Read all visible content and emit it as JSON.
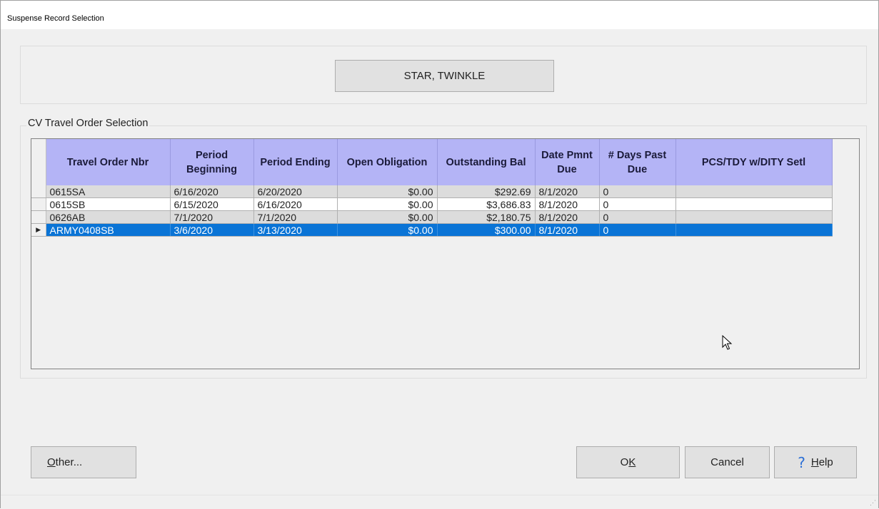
{
  "window": {
    "title": "Suspense Record Selection"
  },
  "member": {
    "name": "STAR, TWINKLE"
  },
  "group": {
    "label": "CV Travel Order Selection"
  },
  "grid": {
    "columns": [
      "Travel Order Nbr",
      "Period Beginning",
      "Period Ending",
      "Open Obligation",
      "Outstanding Bal",
      "Date Pmnt Due",
      "# Days Past Due",
      "PCS/TDY w/DITY Setl"
    ],
    "rows": [
      {
        "order": "0615SA",
        "begin": "6/16/2020",
        "end": "6/20/2020",
        "open": "$0.00",
        "bal": "$292.69",
        "due": "8/1/2020",
        "days": "0",
        "pcs": ""
      },
      {
        "order": "0615SB",
        "begin": "6/15/2020",
        "end": "6/16/2020",
        "open": "$0.00",
        "bal": "$3,686.83",
        "due": "8/1/2020",
        "days": "0",
        "pcs": ""
      },
      {
        "order": "0626AB",
        "begin": "7/1/2020",
        "end": "7/1/2020",
        "open": "$0.00",
        "bal": "$2,180.75",
        "due": "8/1/2020",
        "days": "0",
        "pcs": ""
      },
      {
        "order": "ARMY0408SB",
        "begin": "3/6/2020",
        "end": "3/13/2020",
        "open": "$0.00",
        "bal": "$300.00",
        "due": "8/1/2020",
        "days": "0",
        "pcs": ""
      }
    ],
    "selected_row_index": 3,
    "current_row_marker": "▶"
  },
  "buttons": {
    "other_prefix": "",
    "other_mnemonic": "O",
    "other_rest": "ther...",
    "ok_prefix": "O",
    "ok_mnemonic": "K",
    "cancel": "Cancel",
    "help_mnemonic": "H",
    "help_rest": "elp",
    "help_glyph": "?"
  },
  "colors": {
    "header_bg": "#b4b4f6",
    "selected_row": "#0a74d6",
    "alt_row": "#dcdcdc"
  }
}
